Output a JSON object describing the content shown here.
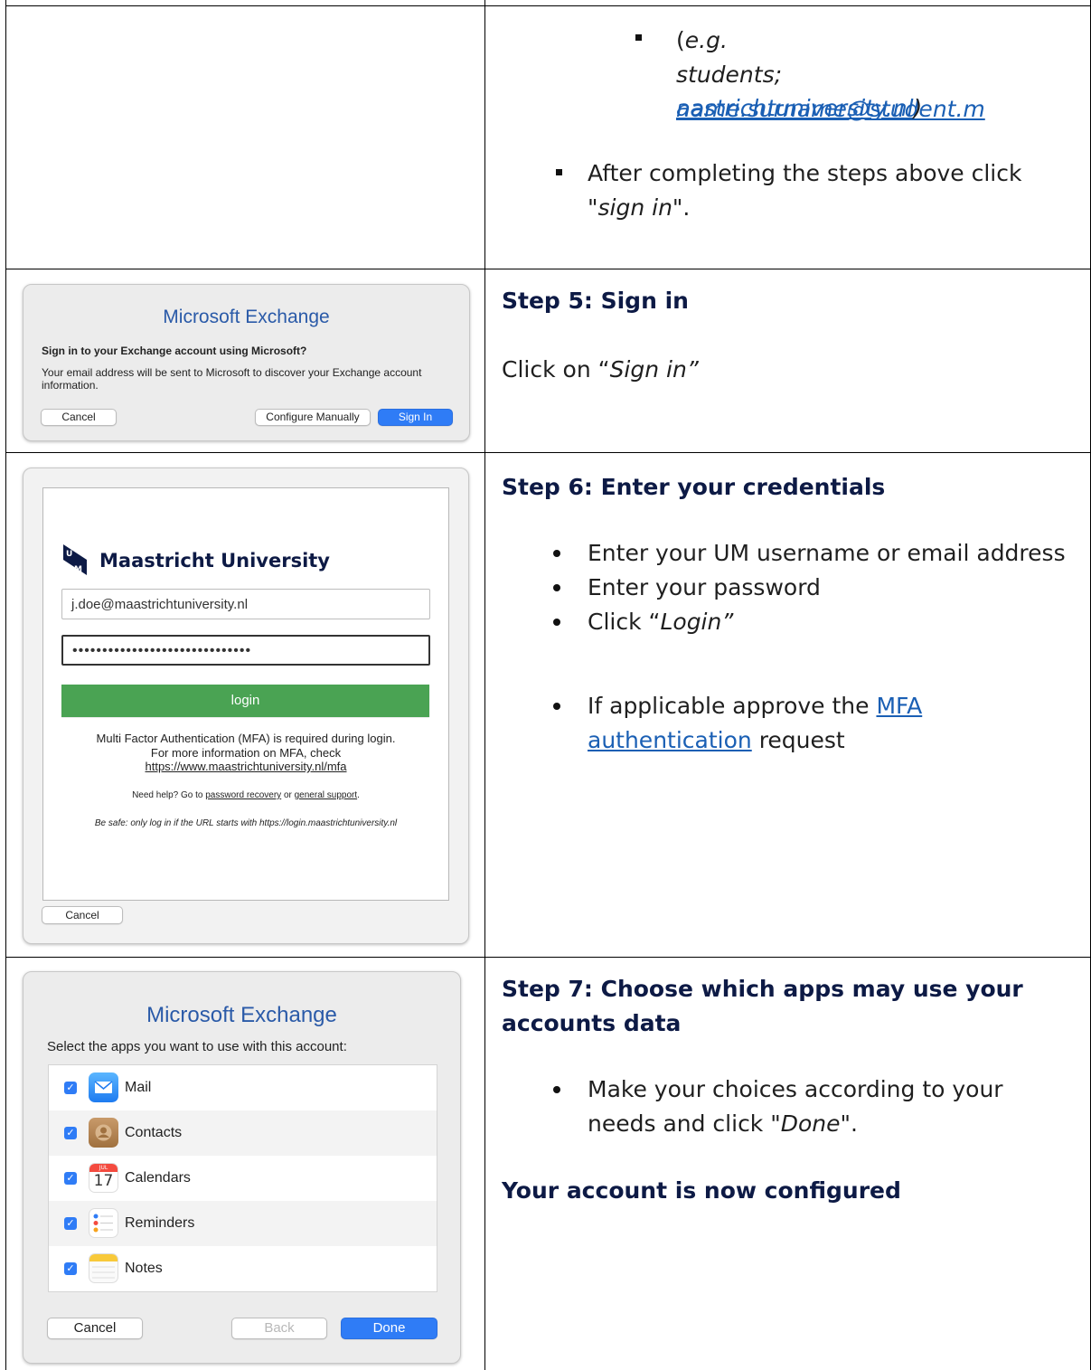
{
  "row1": {
    "eg_prefix": "(",
    "eg_text": "e.g.",
    "students_text": "students; ",
    "email_link_line1": "name.surname@student.m",
    "email_link_line2": "aastrichtuniversity.nl",
    "paren_close": ")",
    "after_text_1": "After completing the steps above click",
    "after_quote_open": "\"",
    "after_signin": "sign in",
    "after_quote_close": "\"."
  },
  "step5": {
    "heading": "Step 5: Sign in",
    "instruction_prefix": "Click on “",
    "instruction_em": "Sign in”",
    "dialog": {
      "title": "Microsoft Exchange",
      "question": "Sign in to your Exchange account using Microsoft?",
      "description_line1": "Your email address will be sent to Microsoft to discover your Exchange account",
      "description_line2": "information.",
      "cancel": "Cancel",
      "configure": "Configure Manually",
      "signin": "Sign In"
    }
  },
  "step6": {
    "heading": "Step 6: Enter your credentials",
    "bullets": [
      "Enter your UM username or email address",
      "Enter your password"
    ],
    "click_prefix": "Click “",
    "click_em": "Login”",
    "mfa_prefix": "If applicable approve the ",
    "mfa_link_1": "MFA",
    "mfa_link_2": "authentication",
    "mfa_suffix": " request",
    "login": {
      "brand": "Maastricht University",
      "username_value": "j.doe@maastrichtuniversity.nl",
      "password_dots": "••••••••••••••••••••••••••••••",
      "button": "login",
      "mfa_line1": "Multi Factor Authentication (MFA) is required during login.",
      "mfa_line2": "For more information on MFA, check",
      "mfa_url": "https://www.maastrichtuniversity.nl/mfa",
      "help_prefix": "Need help? Go to ",
      "help_link1": "password recovery",
      "help_or": " or ",
      "help_link2": "general support",
      "help_suffix": ".",
      "safe_text": "Be safe: only log in if the URL starts with https://login.maastrichtuniversity.nl",
      "cancel": "Cancel",
      "login_color": "#4aa353"
    }
  },
  "step7": {
    "heading_line1": "Step 7: Choose which apps may use your",
    "heading_line2": "accounts data",
    "bullet_line1": "Make your choices according to your",
    "bullet_line2_prefix": "needs and click \"",
    "bullet_em": "Done",
    "bullet_suffix": "\".",
    "configured": "Your account is now configured",
    "dialog": {
      "title": "Microsoft Exchange",
      "subtitle": "Select the apps you want to use with this account:",
      "apps": [
        {
          "label": "Mail",
          "icon": "mail-icon",
          "checked": true
        },
        {
          "label": "Contacts",
          "icon": "contacts-icon",
          "checked": true
        },
        {
          "label": "Calendars",
          "icon": "calendar-icon",
          "checked": true
        },
        {
          "label": "Reminders",
          "icon": "reminders-icon",
          "checked": true
        },
        {
          "label": "Notes",
          "icon": "notes-icon",
          "checked": true
        }
      ],
      "calendar_month": "JUL",
      "calendar_day": "17",
      "cancel": "Cancel",
      "back": "Back",
      "done": "Done"
    }
  }
}
